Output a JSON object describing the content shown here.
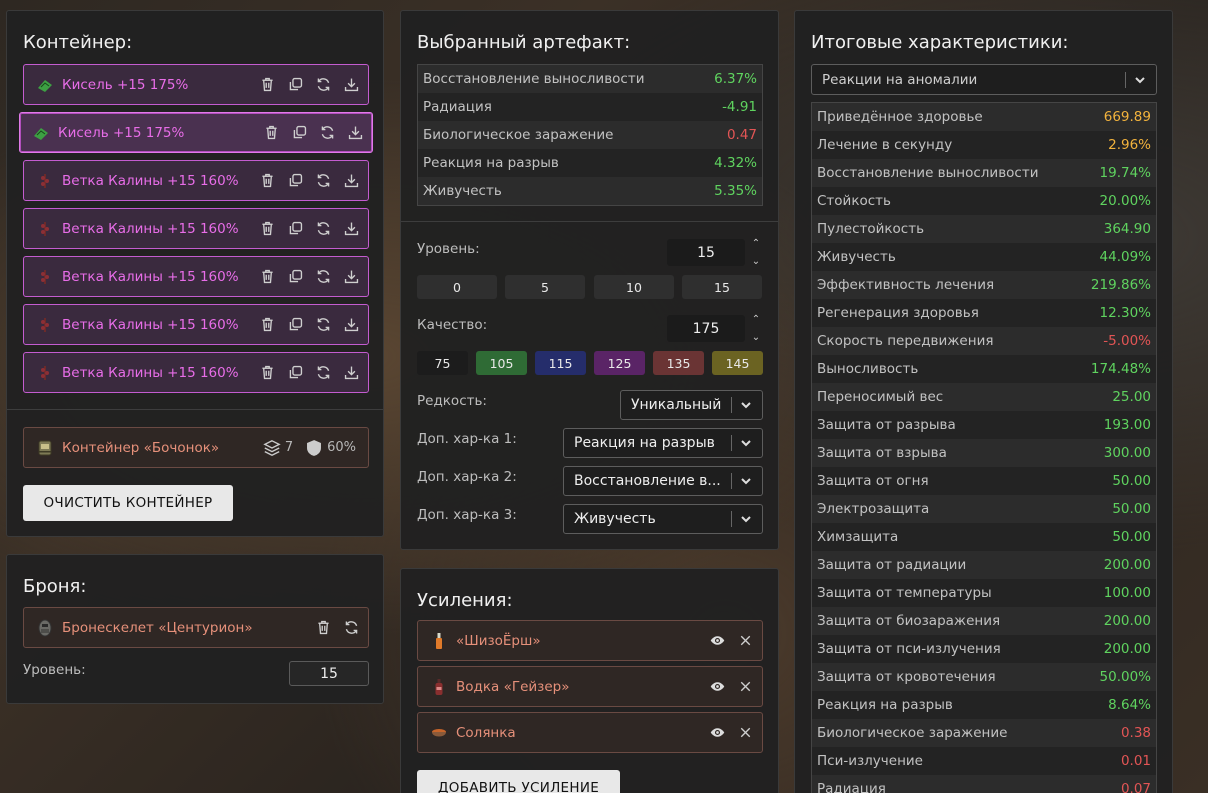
{
  "container": {
    "title": "Контейнер:",
    "artifacts": [
      {
        "label": "Кисель +15 175%",
        "icon": "kisel-icon"
      },
      {
        "label": "Кисель +15 175%",
        "icon": "kisel-icon"
      },
      {
        "label": "Ветка Калины +15 160%",
        "icon": "kalina-icon"
      },
      {
        "label": "Ветка Калины +15 160%",
        "icon": "kalina-icon"
      },
      {
        "label": "Ветка Калины +15 160%",
        "icon": "kalina-icon"
      },
      {
        "label": "Ветка Калины +15 160%",
        "icon": "kalina-icon"
      },
      {
        "label": "Ветка Калины +15 160%",
        "icon": "kalina-icon"
      }
    ],
    "bag": {
      "label": "Контейнер «Бочонок»",
      "slots": "7",
      "protection": "60%"
    },
    "clear_button": "ОЧИСТИТЬ КОНТЕЙНЕР"
  },
  "armor": {
    "title": "Броня:",
    "name": "Бронескелет «Центурион»",
    "level_label": "Уровень:",
    "level": "15"
  },
  "artifact": {
    "title": "Выбранный артефакт:",
    "stats": [
      {
        "name": "Восстановление выносливости",
        "value": "6.37%",
        "tone": "pos"
      },
      {
        "name": "Радиация",
        "value": "-4.91",
        "tone": "pos"
      },
      {
        "name": "Биологическое заражение",
        "value": "0.47",
        "tone": "neg"
      },
      {
        "name": "Реакция на разрыв",
        "value": "4.32%",
        "tone": "pos"
      },
      {
        "name": "Живучесть",
        "value": "5.35%",
        "tone": "pos"
      }
    ],
    "level_label": "Уровень:",
    "level": "15",
    "level_presets": [
      "0",
      "5",
      "10",
      "15"
    ],
    "quality_label": "Качество:",
    "quality": "175",
    "quality_presets": [
      {
        "label": "75",
        "color": "#1c1c1c"
      },
      {
        "label": "105",
        "color": "#2f6b35"
      },
      {
        "label": "115",
        "color": "#252d6b"
      },
      {
        "label": "125",
        "color": "#5a2466"
      },
      {
        "label": "135",
        "color": "#6a3434"
      },
      {
        "label": "145",
        "color": "#6b6322"
      }
    ],
    "rarity_label": "Редкость:",
    "rarity": "Уникальный",
    "extra1_label": "Доп. хар-ка 1:",
    "extra1": "Реакция на разрыв",
    "extra2_label": "Доп. хар-ка 2:",
    "extra2": "Восстановление в...",
    "extra3_label": "Доп. хар-ка 3:",
    "extra3": "Живучесть"
  },
  "boosts": {
    "title": "Усиления:",
    "items": [
      {
        "label": "«ШизоЁрш»"
      },
      {
        "label": "Водка «Гейзер»"
      },
      {
        "label": "Солянка"
      }
    ],
    "add_button": "ДОБАВИТЬ УСИЛЕНИЕ"
  },
  "summary": {
    "title": "Итоговые характеристики:",
    "filter": "Реакции на аномалии",
    "stats": [
      {
        "name": "Приведённое здоровье",
        "value": "669.89",
        "tone": "gold"
      },
      {
        "name": "Лечение в секунду",
        "value": "2.96%",
        "tone": "gold"
      },
      {
        "name": "Восстановление выносливости",
        "value": "19.74%",
        "tone": "pos"
      },
      {
        "name": "Стойкость",
        "value": "20.00%",
        "tone": "pos"
      },
      {
        "name": "Пулестойкость",
        "value": "364.90",
        "tone": "pos"
      },
      {
        "name": "Живучесть",
        "value": "44.09%",
        "tone": "pos"
      },
      {
        "name": "Эффективность лечения",
        "value": "219.86%",
        "tone": "pos"
      },
      {
        "name": "Регенерация здоровья",
        "value": "12.30%",
        "tone": "pos"
      },
      {
        "name": "Скорость передвижения",
        "value": "-5.00%",
        "tone": "neg"
      },
      {
        "name": "Выносливость",
        "value": "174.48%",
        "tone": "pos"
      },
      {
        "name": "Переносимый вес",
        "value": "25.00",
        "tone": "pos"
      },
      {
        "name": "Защита от разрыва",
        "value": "193.00",
        "tone": "pos"
      },
      {
        "name": "Защита от взрыва",
        "value": "300.00",
        "tone": "pos"
      },
      {
        "name": "Защита от огня",
        "value": "50.00",
        "tone": "pos"
      },
      {
        "name": "Электрозащита",
        "value": "50.00",
        "tone": "pos"
      },
      {
        "name": "Химзащита",
        "value": "50.00",
        "tone": "pos"
      },
      {
        "name": "Защита от радиации",
        "value": "200.00",
        "tone": "pos"
      },
      {
        "name": "Защита от температуры",
        "value": "100.00",
        "tone": "pos"
      },
      {
        "name": "Защита от биозаражения",
        "value": "200.00",
        "tone": "pos"
      },
      {
        "name": "Защита от пси-излучения",
        "value": "200.00",
        "tone": "pos"
      },
      {
        "name": "Защита от кровотечения",
        "value": "50.00%",
        "tone": "pos"
      },
      {
        "name": "Реакция на разрыв",
        "value": "8.64%",
        "tone": "pos"
      },
      {
        "name": "Биологическое заражение",
        "value": "0.38",
        "tone": "neg"
      },
      {
        "name": "Пси-излучение",
        "value": "0.01",
        "tone": "neg"
      },
      {
        "name": "Радиация",
        "value": "0.07",
        "tone": "neg"
      }
    ]
  }
}
